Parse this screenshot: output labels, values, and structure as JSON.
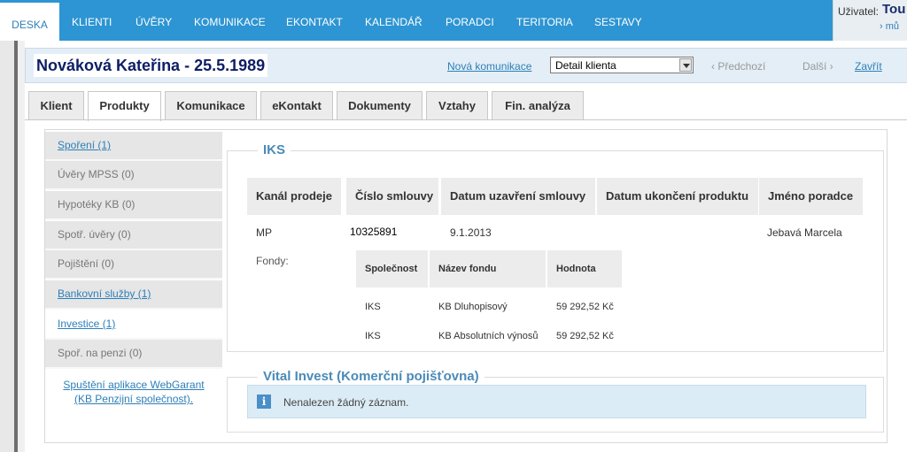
{
  "nav": {
    "items": [
      "DESKA",
      "KLIENTI",
      "ÚVĚRY",
      "KOMUNIKACE",
      "EKONTAKT",
      "KALENDÁŘ",
      "PORADCI",
      "TERITORIA",
      "SESTAVY"
    ],
    "active": "DESKA",
    "user_label": "Uživatel:",
    "user_name": "Tou",
    "user_more": "› mů"
  },
  "header": {
    "client_name": "Nováková Kateřina - 25.5.1989",
    "new_communication": "Nová komunikace",
    "select_value": "Detail klienta",
    "prev": "‹ Předchozí",
    "next": "Další ›",
    "close": "Zavřít"
  },
  "tabs": [
    "Klient",
    "Produkty",
    "Komunikace",
    "eKontakt",
    "Dokumenty",
    "Vztahy",
    "Fin. analýza"
  ],
  "active_tab": "Produkty",
  "sidebar": {
    "items": [
      {
        "label": "Spoření (1)",
        "state": "link"
      },
      {
        "label": "Úvěry MPSS (0)",
        "state": "muted"
      },
      {
        "label": "Hypotéky KB (0)",
        "state": "muted"
      },
      {
        "label": "Spotř. úvěry (0)",
        "state": "muted"
      },
      {
        "label": "Pojištění (0)",
        "state": "muted"
      },
      {
        "label": "Bankovní služby (1)",
        "state": "link"
      },
      {
        "label": "Investice (1)",
        "state": "active"
      },
      {
        "label": "Spoř. na penzi (0)",
        "state": "muted"
      }
    ],
    "link_line1": "Spuštění aplikace WebGarant",
    "link_line2": "(KB Penzijní společnost)."
  },
  "iks": {
    "title": "IKS",
    "columns": [
      "Kanál prodeje",
      "Číslo smlouvy",
      "Datum uzavření smlouvy",
      "Datum ukončení produktu",
      "Jméno poradce"
    ],
    "row": [
      "MP",
      "10325891",
      "9.1.2013",
      "",
      "Jebavá Marcela"
    ],
    "funds_label": "Fondy:",
    "fund_columns": [
      "Společnost",
      "Název fondu",
      "Hodnota"
    ],
    "funds": [
      [
        "IKS",
        "KB Dluhopisový",
        "59 292,52 Kč"
      ],
      [
        "IKS",
        "KB Absolutních výnosů",
        "59 292,52 Kč"
      ]
    ]
  },
  "vital": {
    "title": "Vital Invest (Komerční pojišťovna)",
    "info_icon": "info-icon",
    "message": "Nenalezen žádný záznam."
  }
}
